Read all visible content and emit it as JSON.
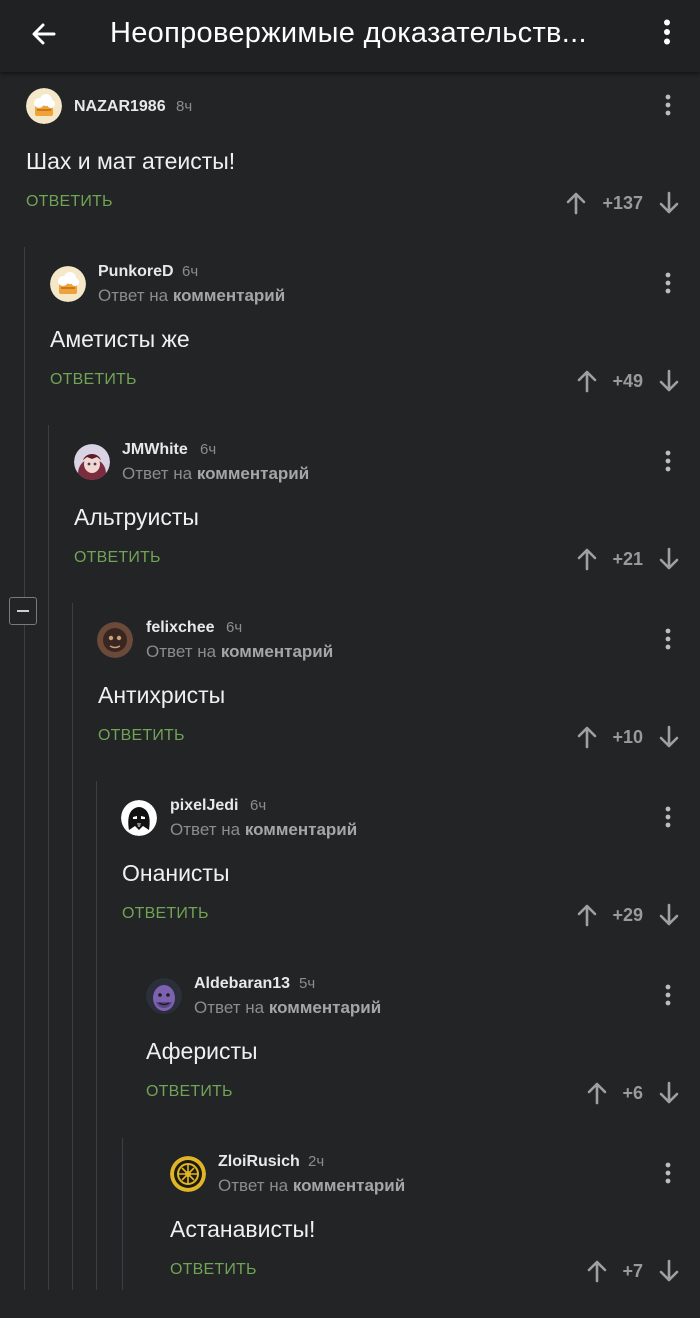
{
  "header": {
    "title": "Неопровержимые доказательств...",
    "back_icon": "arrow-left-icon",
    "menu_icon": "more-vertical-icon"
  },
  "comments": [
    {
      "author": "NAZAR1986",
      "time": "8ч",
      "reply_prefix": "",
      "reply_target": "",
      "text": "Шах и мат атеисты!",
      "reply_label": "ОТВЕТИТЬ",
      "rating": "+137",
      "avatar": "chef-hat-avatar"
    },
    {
      "author": "PunkoreD",
      "time": "6ч",
      "reply_prefix": "Ответ на",
      "reply_target": "комментарий",
      "text": "Аметисты же",
      "reply_label": "ОТВЕТИТЬ",
      "rating": "+49",
      "avatar": "chef-hat-avatar"
    },
    {
      "author": "JMWhite",
      "time": "6ч",
      "reply_prefix": "Ответ на",
      "reply_target": "комментарий",
      "text": "Альтруисты",
      "reply_label": "ОТВЕТИТЬ",
      "rating": "+21",
      "avatar": "anime-girl-avatar"
    },
    {
      "author": "felixchee",
      "time": "6ч",
      "reply_prefix": "Ответ на",
      "reply_target": "комментарий",
      "text": "Антихристы",
      "reply_label": "ОТВЕТИТЬ",
      "rating": "+10",
      "avatar": "dark-face-avatar"
    },
    {
      "author": "pixelJedi",
      "time": "6ч",
      "reply_prefix": "Ответ на",
      "reply_target": "комментарий",
      "text": "Онанисты",
      "reply_label": "ОТВЕТИТЬ",
      "rating": "+29",
      "avatar": "darth-vader-avatar"
    },
    {
      "author": "Aldebaran13",
      "time": "5ч",
      "reply_prefix": "Ответ на",
      "reply_target": "комментарий",
      "text": "Аферисты",
      "reply_label": "ОТВЕТИТЬ",
      "rating": "+6",
      "avatar": "thanos-avatar"
    },
    {
      "author": "ZloiRusich",
      "time": "2ч",
      "reply_prefix": "Ответ на",
      "reply_target": "комментарий",
      "text": "Астанависты!",
      "reply_label": "ОТВЕТИТЬ",
      "rating": "+7",
      "avatar": "ornament-avatar"
    }
  ],
  "colors": {
    "background": "#222426",
    "reply_button": "#71a356",
    "rating": "#9a9a9a"
  }
}
